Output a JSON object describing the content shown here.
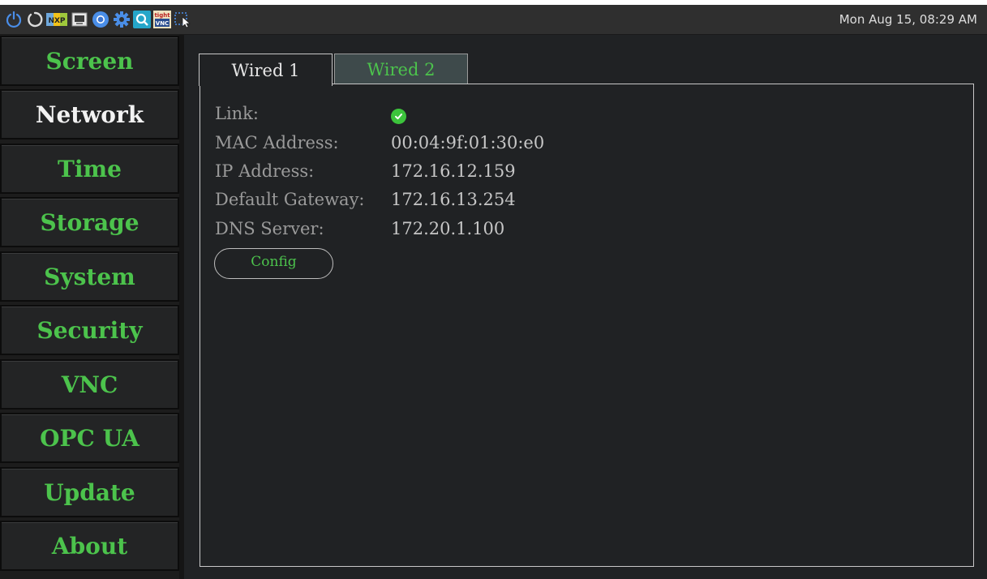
{
  "taskbar": {
    "clock": "Mon Aug 15, 08:29 AM",
    "icons": [
      "power-icon",
      "restart-icon",
      "nxp-icon",
      "terminal-icon",
      "chromium-icon",
      "settings-gear-icon",
      "search-app-icon",
      "tight-vnc-icon",
      "screenshot-icon"
    ],
    "vnc_icon_text_top": "tight",
    "vnc_icon_text_bottom": "VNC",
    "nxp_icon_text": "NXP"
  },
  "sidebar": {
    "items": [
      {
        "label": "Screen"
      },
      {
        "label": "Network",
        "active": true
      },
      {
        "label": "Time"
      },
      {
        "label": "Storage"
      },
      {
        "label": "System"
      },
      {
        "label": "Security"
      },
      {
        "label": "VNC"
      },
      {
        "label": "OPC UA"
      },
      {
        "label": "Update"
      },
      {
        "label": "About"
      }
    ]
  },
  "tabs": [
    {
      "label": "Wired 1",
      "active": true
    },
    {
      "label": "Wired 2",
      "active": false
    }
  ],
  "wired1": {
    "link_label": "Link:",
    "link_status": "connected",
    "mac_label": "MAC Address:",
    "mac_value": "00:04:9f:01:30:e0",
    "ip_label": "IP Address:",
    "ip_value": "172.16.12.159",
    "gateway_label": "Default Gateway:",
    "gateway_value": "172.16.13.254",
    "dns_label": "DNS Server:",
    "dns_value": "172.20.1.100",
    "config_label": "Config"
  },
  "colors": {
    "accent_green": "#4cc34c",
    "active_text": "#f2f2f2",
    "background": "#202224"
  }
}
